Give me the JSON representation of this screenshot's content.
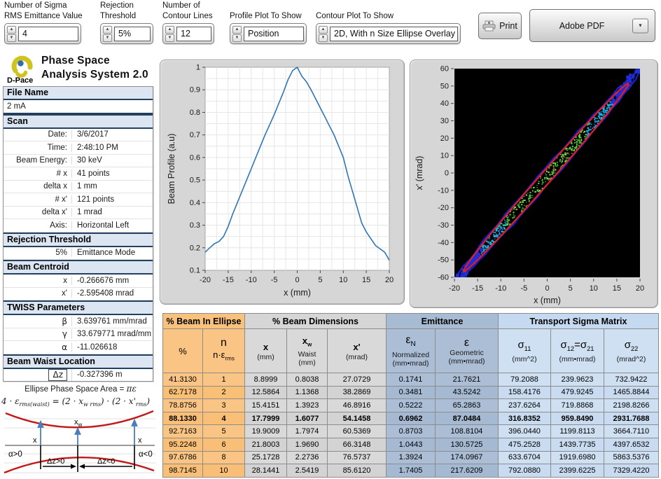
{
  "toolbar": {
    "controls": [
      {
        "label1": "Number of Sigma",
        "label2": "RMS Emittance Value",
        "value": "4"
      },
      {
        "label1": "Rejection",
        "label2": "Threshold",
        "value": "5%"
      },
      {
        "label1": "Number of",
        "label2": "Contour Lines",
        "value": "12"
      },
      {
        "label1": "",
        "label2": "Profile Plot To Show",
        "value": "Position"
      },
      {
        "label1": "",
        "label2": "Contour Plot To Show",
        "value": "2D, With n Size Ellipse Overlay"
      }
    ],
    "print_label": "Print",
    "adobe_pdf_label": "Adobe PDF"
  },
  "branding": {
    "logo_text": "D-Pace",
    "title_line1": "Phase Space",
    "title_line2": "Analysis System 2.0"
  },
  "sidebar": {
    "sections": [
      {
        "header": "File Name",
        "rows": [
          {
            "label": "",
            "value": "2 mA",
            "full": true,
            "darksep": true
          }
        ]
      },
      {
        "header": "Scan",
        "rows": [
          {
            "label": "Date:",
            "value": "3/6/2017"
          },
          {
            "label": "Time:",
            "value": "2:48:10 PM"
          },
          {
            "label": "Beam Energy:",
            "value": "30 keV"
          },
          {
            "label": "# x",
            "value": "41 points"
          },
          {
            "label": "delta x",
            "value": "1 mm"
          },
          {
            "label": "# x'",
            "value": "121 points"
          },
          {
            "label": "delta x'",
            "value": "1 mrad"
          },
          {
            "label": "Axis:",
            "value": "Horizontal Left"
          }
        ]
      },
      {
        "header": "Rejection Threshold",
        "rows": [
          {
            "label": "5%",
            "value": "Emittance Mode"
          }
        ]
      },
      {
        "header": "Beam Centroid",
        "rows": [
          {
            "label": "x",
            "value": "-0.266676 mm"
          },
          {
            "label": "x'",
            "value": "-2.595408 mrad"
          }
        ]
      },
      {
        "header": "TWISS Parameters",
        "rows": [
          {
            "label": "β",
            "value": "3.639761 mm/mrad",
            "greek": true
          },
          {
            "label": "γ",
            "value": "33.679771 mrad/mm",
            "greek": true
          },
          {
            "label": "α",
            "value": "-11.026618",
            "greek": true
          }
        ]
      },
      {
        "header": "Beam Waist Location",
        "rows": [
          {
            "label": "Δz",
            "value": "-0.327396 m",
            "greek": true,
            "boxed": true
          }
        ]
      }
    ]
  },
  "diagram": {
    "title_text": "Ellipse Phase Space Area = ",
    "title_math": "πε",
    "formula": {
      "p1": "4 · ε",
      "s1": "rms(waist)",
      "p2": " = (2 · x",
      "s2": "w rms",
      "p3": ") · (2 · x'",
      "s3": "rms",
      "p4": ")"
    },
    "labels": {
      "x_left": "x",
      "x_right": "x",
      "xw_main": "x",
      "xw_sub": "w",
      "alpha_left": "α>0",
      "alpha_right": "α<0",
      "dz_pos": "Δz>0",
      "dz_neg": "Δz<0"
    }
  },
  "profile_chart": {
    "type": "line",
    "xlabel": "x (mm)",
    "ylabel": "Beam Profile (a.u)",
    "xlim": [
      -20,
      20
    ],
    "ylim": [
      0.1,
      1
    ],
    "xtick_step": 5,
    "ytick_step": 0.1,
    "grid_x_step": 2.5,
    "grid_y_step": 0.05,
    "line_color": "#2E75B6",
    "x": [
      -20,
      -19,
      -18,
      -17,
      -16,
      -15,
      -14,
      -13,
      -12,
      -11,
      -10,
      -9,
      -8,
      -7,
      -6,
      -5,
      -4,
      -3,
      -2,
      -1,
      0,
      1,
      2,
      3,
      4,
      5,
      6,
      7,
      8,
      9,
      10,
      11,
      12,
      13,
      14,
      15,
      16,
      17,
      18,
      19,
      20
    ],
    "y": [
      0.18,
      0.2,
      0.218,
      0.228,
      0.25,
      0.295,
      0.35,
      0.4,
      0.45,
      0.5,
      0.55,
      0.6,
      0.65,
      0.7,
      0.745,
      0.79,
      0.84,
      0.89,
      0.945,
      0.985,
      1.0,
      0.96,
      0.935,
      0.9,
      0.86,
      0.82,
      0.78,
      0.74,
      0.7,
      0.65,
      0.6,
      0.52,
      0.45,
      0.38,
      0.31,
      0.27,
      0.24,
      0.21,
      0.195,
      0.18,
      0.145
    ]
  },
  "contour_chart": {
    "type": "scatter",
    "xlabel": "x (mm)",
    "ylabel": "x' (mrad)",
    "xlim": [
      -20,
      20
    ],
    "ylim": [
      -60,
      60
    ],
    "xtick_step": 5,
    "ytick_step": 10,
    "twiss": {
      "beta": 3.639761,
      "gamma": 33.679771,
      "alpha": -11.026618
    },
    "ellipse_n": 4,
    "ellipse_geometric_emittance": 87.0484,
    "centroid_x": -0.266676,
    "centroid_xp": -2.595408,
    "colors": {
      "bg": "#000000",
      "ellipse": "#E31E1E",
      "outer_contour": "#2121CC",
      "blue": "#1E2ED8",
      "cyan": "#18B8E0",
      "teal": "#2090E8",
      "green": "#30C840",
      "green2": "#6FE050",
      "hot": "#E8A030",
      "red_dot": "#E05050"
    }
  },
  "results_table": {
    "groups": [
      {
        "label": "% Beam In Ellipse",
        "span": 2,
        "cls": "g-or"
      },
      {
        "label": "% Beam Dimensions",
        "span": 3,
        "cls": "g-gr"
      },
      {
        "label": "Emittance",
        "span": 2,
        "cls": "g-em"
      },
      {
        "label": "Transport Sigma Matrix",
        "span": 3,
        "cls": "g-sg"
      }
    ],
    "columns": [
      {
        "lines": [
          [
            {
              "t": "%"
            }
          ]
        ]
      },
      {
        "lines": [
          [
            {
              "t": "n"
            }
          ],
          [
            {
              "t": "n·ε"
            },
            {
              "s": "rms"
            }
          ]
        ]
      },
      {
        "lines": [
          [
            {
              "t": "x"
            }
          ],
          [
            {
              "t": "(mm)"
            }
          ]
        ]
      },
      {
        "lines": [
          [
            {
              "t": "x"
            },
            {
              "s": "w"
            }
          ],
          [
            {
              "t": "Waist"
            }
          ],
          [
            {
              "t": "(mm)"
            }
          ]
        ]
      },
      {
        "lines": [
          [
            {
              "t": "x'"
            }
          ],
          [
            {
              "t": "(mrad)"
            }
          ]
        ]
      },
      {
        "lines": [
          [
            {
              "t": "ε"
            },
            {
              "s": "N"
            }
          ],
          [
            {
              "t": "Normalized"
            }
          ],
          [
            {
              "t": "(mm•mrad)"
            }
          ]
        ]
      },
      {
        "lines": [
          [
            {
              "t": "ε"
            }
          ],
          [
            {
              "t": "Geometric"
            }
          ],
          [
            {
              "t": "(mm•mrad)"
            }
          ]
        ]
      },
      {
        "lines": [
          [
            {
              "t": "σ"
            },
            {
              "s": "11"
            }
          ],
          [
            {
              "t": "(mm^2)"
            }
          ]
        ]
      },
      {
        "lines": [
          [
            {
              "t": "σ"
            },
            {
              "s": "12"
            },
            {
              "t": "=σ"
            },
            {
              "s": "21"
            }
          ],
          [
            {
              "t": "(mm•mrad)"
            }
          ]
        ]
      },
      {
        "lines": [
          [
            {
              "t": "σ"
            },
            {
              "s": "22"
            }
          ],
          [
            {
              "t": "(mrad^2)"
            }
          ]
        ]
      }
    ],
    "bold_row_index": 3,
    "rows": [
      [
        "41.3130",
        "1",
        "8.8999",
        "0.8038",
        "27.0729",
        "0.1741",
        "21.7621",
        "79.2088",
        "239.9623",
        "732.9422"
      ],
      [
        "62.7178",
        "2",
        "12.5864",
        "1.1368",
        "38.2869",
        "0.3481",
        "43.5242",
        "158.4176",
        "479.9245",
        "1465.8844"
      ],
      [
        "78.8756",
        "3",
        "15.4151",
        "1.3923",
        "46.8916",
        "0.5222",
        "65.2863",
        "237.6264",
        "719.8868",
        "2198.8266"
      ],
      [
        "88.1330",
        "4",
        "17.7999",
        "1.6077",
        "54.1458",
        "0.6962",
        "87.0484",
        "316.8352",
        "959.8490",
        "2931.7688"
      ],
      [
        "92.7163",
        "5",
        "19.9009",
        "1.7974",
        "60.5369",
        "0.8703",
        "108.8104",
        "396.0440",
        "1199.8113",
        "3664.7110"
      ],
      [
        "95.2248",
        "6",
        "21.8003",
        "1.9690",
        "66.3148",
        "1.0443",
        "130.5725",
        "475.2528",
        "1439.7735",
        "4397.6532"
      ],
      [
        "97.6786",
        "8",
        "25.1728",
        "2.2736",
        "76.5737",
        "1.3924",
        "174.0967",
        "633.6704",
        "1919.6980",
        "5863.5376"
      ],
      [
        "98.7145",
        "10",
        "28.1441",
        "2.5419",
        "85.6120",
        "1.7405",
        "217.6209",
        "792.0880",
        "2399.6225",
        "7329.4220"
      ]
    ]
  }
}
